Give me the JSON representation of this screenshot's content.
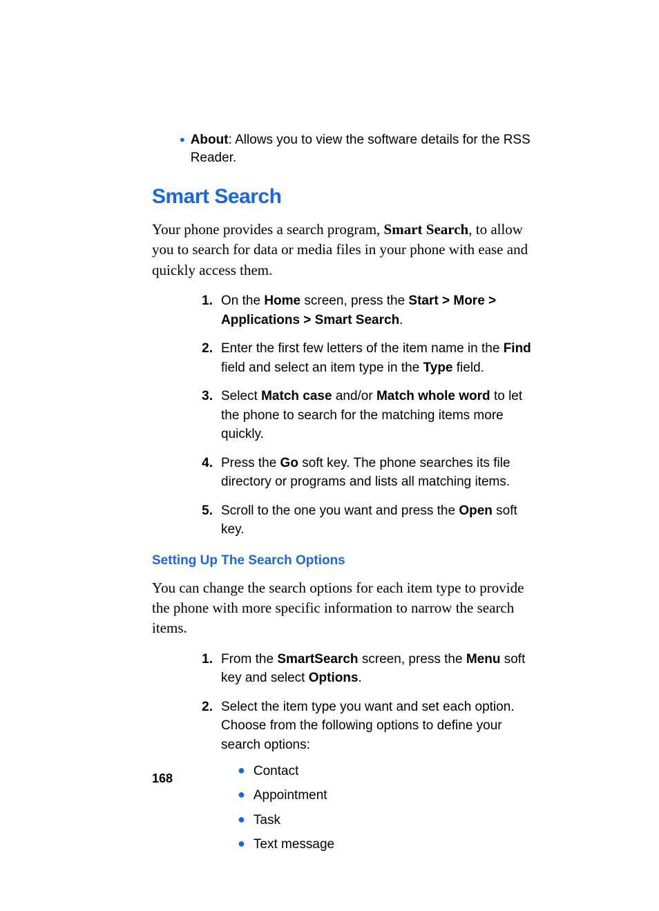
{
  "top_bullet": {
    "bold": "About",
    "rest": ": Allows you to view the software details for the RSS Reader."
  },
  "section_title": "Smart Search",
  "intro_before_bold": "Your phone provides a search program, ",
  "intro_bold": "Smart Search",
  "intro_after_bold": ", to allow you to search for data or media files in your phone with ease and quickly access them.",
  "steps1": {
    "s1": {
      "num": "1.",
      "p1": "On the ",
      "b1": "Home",
      "p2": " screen, press the ",
      "b2": "Start > More > Applications > Smart Search",
      "p3": "."
    },
    "s2": {
      "num": "2.",
      "p1": "Enter the first few letters of the item name in the ",
      "b1": "Find",
      "p2": " field and select an item type in the ",
      "b2": "Type",
      "p3": " field."
    },
    "s3": {
      "num": "3.",
      "p1": "Select ",
      "b1": "Match case",
      "p2": " and/or ",
      "b2": "Match whole word",
      "p3": " to let the phone to search for the matching items more quickly."
    },
    "s4": {
      "num": "4.",
      "p1": "Press the ",
      "b1": "Go",
      "p2": " soft key. The phone searches its file directory or programs and lists all matching items."
    },
    "s5": {
      "num": "5.",
      "p1": "Scroll to the one you want and press the ",
      "b1": "Open",
      "p2": " soft key."
    }
  },
  "subheading": "Setting Up The Search Options",
  "paragraph2": "You can change the search options for each item type to provide the phone with more specific information to narrow the search items.",
  "steps2": {
    "s1": {
      "num": "1.",
      "p1": "From the ",
      "b1": "SmartSearch",
      "p2": " screen, press the ",
      "b2": "Menu",
      "p3": " soft key and select ",
      "b3": "Options",
      "p4": "."
    },
    "s2": {
      "num": "2.",
      "p1": "Select the item type you want and set each option. Choose from the following options to define your search options:"
    }
  },
  "options": {
    "o1": "Contact",
    "o2": "Appointment",
    "o3": "Task",
    "o4": "Text message"
  },
  "page_number": "168"
}
